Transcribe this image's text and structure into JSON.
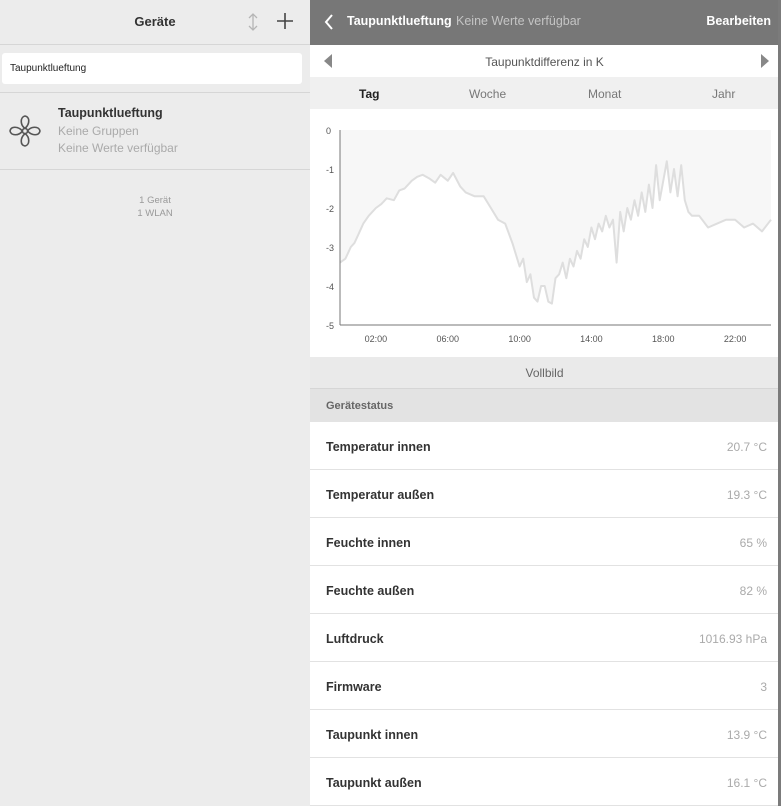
{
  "left": {
    "title": "Geräte",
    "search_value": "Taupunktlueftung",
    "device": {
      "name": "Taupunktlueftung",
      "groups": "Keine Gruppen",
      "values": "Keine Werte verfügbar",
      "icon": "fan-icon"
    },
    "summary": {
      "devices": "1 Gerät",
      "wlan": "1 WLAN"
    }
  },
  "topbar": {
    "title": "Taupunktlueftung",
    "subtitle": "Keine Werte verfügbar",
    "edit_label": "Bearbeiten"
  },
  "chart_header": {
    "title": "Taupunktdifferenz in K"
  },
  "tabs": [
    {
      "label": "Tag",
      "active": true
    },
    {
      "label": "Woche",
      "active": false
    },
    {
      "label": "Monat",
      "active": false
    },
    {
      "label": "Jahr",
      "active": false
    }
  ],
  "chart_data": {
    "type": "line",
    "title": "Taupunktdifferenz in K",
    "xlabel": "",
    "ylabel": "",
    "ylim": [
      -5,
      0
    ],
    "xlim_hours": [
      0,
      24
    ],
    "y_ticks": [
      "0",
      "-1",
      "-2",
      "-3",
      "-4",
      "-5"
    ],
    "x_ticks": [
      {
        "hour": 2,
        "label": "02:00"
      },
      {
        "hour": 6,
        "label": "06:00"
      },
      {
        "hour": 10,
        "label": "10:00"
      },
      {
        "hour": 14,
        "label": "14:00"
      },
      {
        "hour": 18,
        "label": "18:00"
      },
      {
        "hour": 22,
        "label": "22:00"
      }
    ],
    "line_color": "#dedede",
    "fill_color": "#f7f7f7",
    "grid": false,
    "series": [
      {
        "x": [
          0.0,
          0.3,
          0.6,
          0.8,
          1.0,
          1.3,
          1.6,
          2.0,
          2.3,
          2.6,
          3.0,
          3.3,
          3.6,
          4.0,
          4.3,
          4.6,
          5.0,
          5.3,
          5.6,
          6.0,
          6.3,
          6.7,
          7.0,
          7.5,
          8.0,
          8.4,
          8.8,
          9.2,
          9.6,
          10.0,
          10.2,
          10.4,
          10.6,
          10.8,
          11.0,
          11.2,
          11.4,
          11.6,
          11.8,
          12.0,
          12.2,
          12.4,
          12.6,
          12.8,
          13.0,
          13.2,
          13.4,
          13.6,
          13.8,
          14.0,
          14.2,
          14.4,
          14.6,
          14.8,
          15.0,
          15.2,
          15.4,
          15.6,
          15.8,
          16.0,
          16.2,
          16.4,
          16.6,
          16.8,
          17.0,
          17.2,
          17.4,
          17.6,
          17.8,
          18.0,
          18.2,
          18.4,
          18.6,
          18.8,
          19.0,
          19.2,
          19.4,
          19.6,
          20.0,
          20.5,
          21.0,
          21.5,
          22.0,
          22.5,
          23.0,
          23.5,
          24.0
        ],
        "values": [
          -3.4,
          -3.3,
          -3.0,
          -2.9,
          -2.7,
          -2.4,
          -2.2,
          -2.0,
          -1.9,
          -1.75,
          -1.8,
          -1.55,
          -1.5,
          -1.3,
          -1.2,
          -1.15,
          -1.25,
          -1.35,
          -1.15,
          -1.3,
          -1.1,
          -1.45,
          -1.6,
          -1.7,
          -1.7,
          -2.0,
          -2.3,
          -2.4,
          -2.9,
          -3.5,
          -3.3,
          -3.9,
          -3.7,
          -4.3,
          -4.4,
          -4.0,
          -4.0,
          -4.4,
          -4.45,
          -3.8,
          -3.7,
          -3.4,
          -3.8,
          -3.3,
          -3.5,
          -3.1,
          -3.3,
          -2.8,
          -3.0,
          -2.5,
          -2.8,
          -2.4,
          -2.6,
          -2.2,
          -2.5,
          -2.3,
          -3.4,
          -2.1,
          -2.6,
          -2.0,
          -2.3,
          -1.8,
          -2.2,
          -1.6,
          -2.1,
          -1.4,
          -2.0,
          -0.9,
          -1.8,
          -1.3,
          -0.8,
          -1.6,
          -1.0,
          -1.7,
          -0.9,
          -1.8,
          -2.1,
          -2.2,
          -2.2,
          -2.5,
          -2.4,
          -2.3,
          -2.3,
          -2.5,
          -2.4,
          -2.6,
          -2.3
        ]
      }
    ]
  },
  "vollbild_label": "Vollbild",
  "status": {
    "heading": "Gerätestatus",
    "rows": [
      {
        "label": "Temperatur innen",
        "value": "20.7 °C"
      },
      {
        "label": "Temperatur außen",
        "value": "19.3 °C"
      },
      {
        "label": "Feuchte innen",
        "value": "65 %"
      },
      {
        "label": "Feuchte außen",
        "value": "82 %"
      },
      {
        "label": "Luftdruck",
        "value": "1016.93 hPa"
      },
      {
        "label": "Firmware",
        "value": "3"
      },
      {
        "label": "Taupunkt innen",
        "value": "13.9 °C"
      },
      {
        "label": "Taupunkt außen",
        "value": "16.1 °C"
      }
    ]
  }
}
